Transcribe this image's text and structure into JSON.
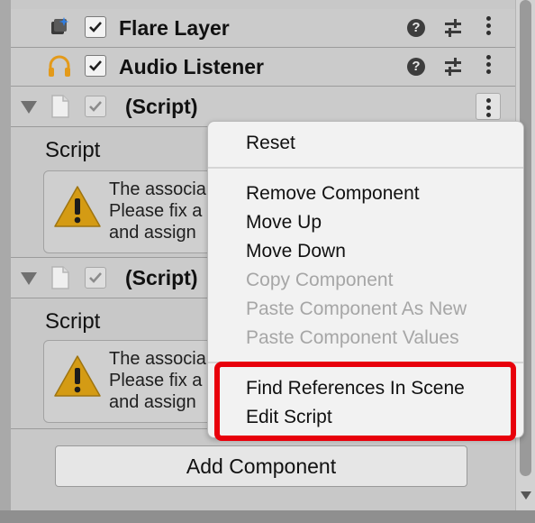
{
  "components": {
    "flare_layer": {
      "title": "Flare Layer",
      "enabled": true
    },
    "audio_listener": {
      "title": "Audio Listener",
      "enabled": true
    },
    "scripts": [
      {
        "title": "(Script)",
        "field_label": "Script",
        "warning_text": "The associa\nPlease fix a\nand assign"
      },
      {
        "title": "(Script)",
        "field_label": "Script",
        "warning_text": "The associa\nPlease fix a\nand assign"
      }
    ]
  },
  "add_component_label": "Add Component",
  "context_menu": {
    "items": [
      {
        "label": "Reset",
        "enabled": true
      },
      {
        "label": "Remove Component",
        "enabled": true
      },
      {
        "label": "Move Up",
        "enabled": true
      },
      {
        "label": "Move Down",
        "enabled": true
      },
      {
        "label": "Copy Component",
        "enabled": false
      },
      {
        "label": "Paste Component As New",
        "enabled": false
      },
      {
        "label": "Paste Component Values",
        "enabled": false
      },
      {
        "label": "Find References In Scene",
        "enabled": true,
        "highlighted": true
      },
      {
        "label": "Edit Script",
        "enabled": true,
        "highlighted": true
      }
    ]
  },
  "colors": {
    "highlight_border": "#e8000b",
    "audio_icon": "#e39a1a",
    "warning_icon": "#d49b14",
    "flare_icon_accent": "#2f7de1"
  },
  "icons": {
    "flare": "flare-layer-icon",
    "audio": "headphones-icon",
    "help": "help-icon",
    "presets": "sliders-icon",
    "more": "kebab-menu-icon",
    "warning": "warning-icon",
    "script": "script-file-icon",
    "foldout": "foldout-triangle-icon"
  }
}
